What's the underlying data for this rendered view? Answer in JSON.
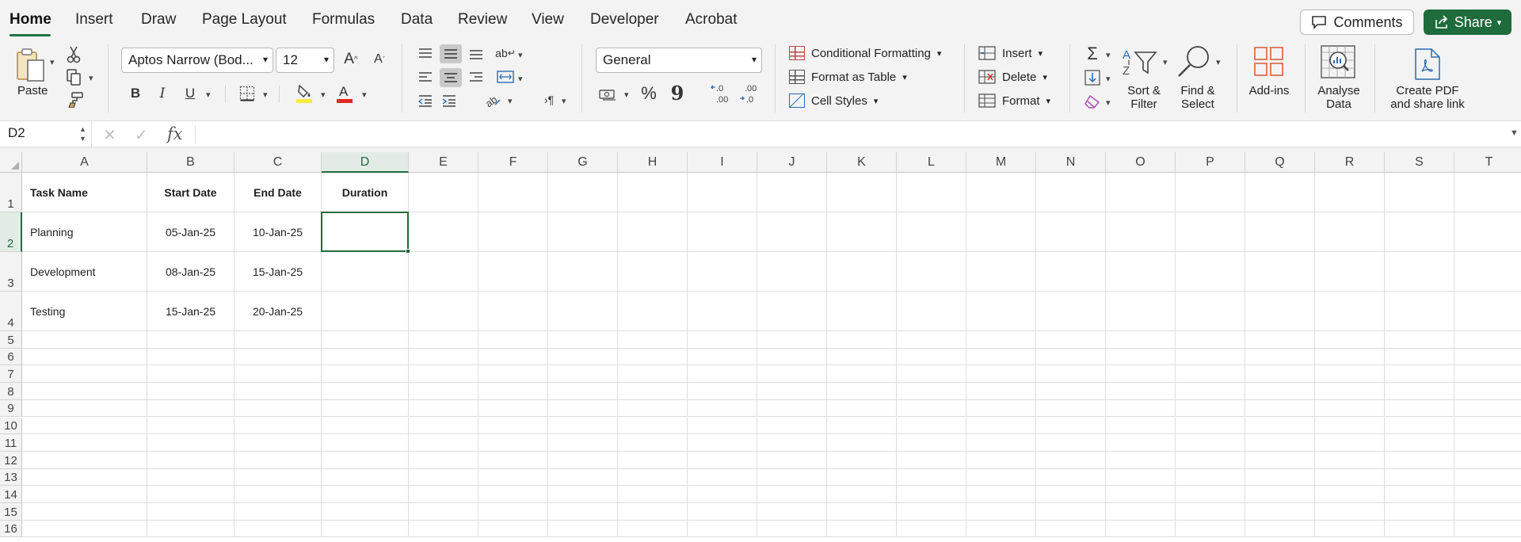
{
  "tabs": [
    {
      "label": "Home",
      "active": true
    },
    {
      "label": "Insert"
    },
    {
      "label": "Draw"
    },
    {
      "label": "Page Layout"
    },
    {
      "label": "Formulas"
    },
    {
      "label": "Data"
    },
    {
      "label": "Review"
    },
    {
      "label": "View"
    },
    {
      "label": "Developer"
    },
    {
      "label": "Acrobat"
    }
  ],
  "header": {
    "comments_label": "Comments",
    "share_label": "Share"
  },
  "ribbon": {
    "paste_label": "Paste",
    "font_name": "Aptos Narrow (Bod...",
    "font_size": "12",
    "bold_label": "B",
    "italic_label": "I",
    "underline_label": "U",
    "number_format": "General",
    "conditional_formatting_label": "Conditional Formatting",
    "format_as_table_label": "Format as Table",
    "cell_styles_label": "Cell Styles",
    "insert_label": "Insert",
    "delete_label": "Delete",
    "format_label": "Format",
    "sort_filter_label_1": "Sort &",
    "sort_filter_label_2": "Filter",
    "find_select_label_1": "Find &",
    "find_select_label_2": "Select",
    "addins_label": "Add-ins",
    "analyse_label_1": "Analyse",
    "analyse_label_2": "Data",
    "create_pdf_label_1": "Create PDF",
    "create_pdf_label_2": "and share link",
    "percent_glyph": "%",
    "comma_glyph": "9"
  },
  "formula_bar": {
    "name_box": "D2",
    "formula": ""
  },
  "accent_color": "#1e6b3c",
  "sheet": {
    "columns": [
      "A",
      "B",
      "C",
      "D",
      "E",
      "F",
      "G",
      "H",
      "I",
      "J",
      "K",
      "L",
      "M",
      "N",
      "O",
      "P",
      "Q",
      "R",
      "S",
      "T"
    ],
    "rows": [
      "1",
      "2",
      "3",
      "4",
      "5",
      "6",
      "7",
      "8",
      "9",
      "10",
      "11",
      "12",
      "13",
      "14",
      "15",
      "16"
    ],
    "selected_cell": "D2",
    "cells": {
      "A1": "Task Name",
      "B1": "Start Date",
      "C1": "End Date",
      "D1": "Duration",
      "A2": "Planning",
      "B2": "05-Jan-25",
      "C2": "10-Jan-25",
      "D2": "",
      "A3": "Development",
      "B3": "08-Jan-25",
      "C3": "15-Jan-25",
      "D3": "",
      "A4": "Testing",
      "B4": "15-Jan-25",
      "C4": "20-Jan-25",
      "D4": ""
    }
  }
}
